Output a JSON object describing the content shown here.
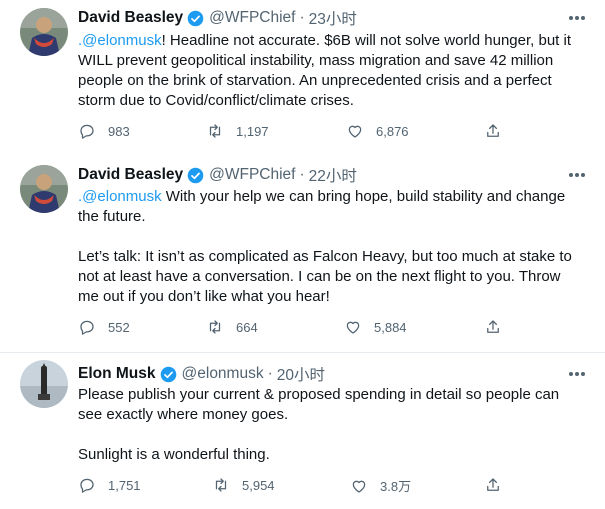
{
  "tweets": [
    {
      "name": "David Beasley",
      "handle": "@WFPChief",
      "time": "23小时",
      "mention": ".@elonmusk",
      "text": "! Headline not accurate. $6B will not solve world hunger, but it WILL prevent geopolitical instability, mass migration and save 42 million people on the brink of starvation. An unprecedented crisis and a perfect storm due to Covid/conflict/climate crises.",
      "replies": "983",
      "retweets": "1,197",
      "likes": "6,876"
    },
    {
      "name": "David Beasley",
      "handle": "@WFPChief",
      "time": "22小时",
      "mention": ".@elonmusk",
      "text": " With your help we can bring hope, build stability and change the future.\n\nLet’s talk: It isn’t as complicated as Falcon Heavy, but too much at stake to not at least have a conversation. I can be on the next flight to you. Throw me out if you don’t like what you hear!",
      "replies": "552",
      "retweets": "664",
      "likes": "5,884"
    },
    {
      "name": "Elon Musk",
      "handle": "@elonmusk",
      "time": "20小时",
      "mention": "",
      "text": "Please publish your current & proposed spending in detail so people can see exactly where money goes.\n\nSunlight is a wonderful thing.",
      "replies": "1,751",
      "retweets": "5,954",
      "likes": "3.8万"
    }
  ],
  "separator": "·",
  "colors": {
    "accent": "#1d9bf0",
    "muted": "#536471",
    "text": "#0f1419"
  },
  "icons": [
    "reply-icon",
    "retweet-icon",
    "like-icon",
    "share-icon",
    "verified-badge-icon",
    "more-icon"
  ]
}
